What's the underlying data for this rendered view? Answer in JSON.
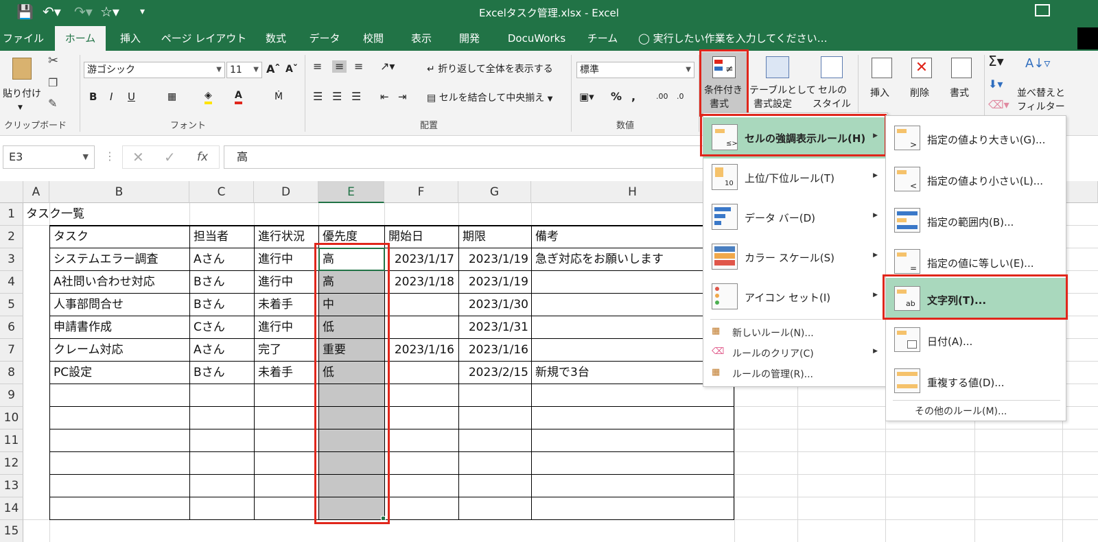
{
  "title": "Excelタスク管理.xlsx - Excel",
  "tabs": [
    "ファイル",
    "ホーム",
    "挿入",
    "ページ レイアウト",
    "数式",
    "データ",
    "校閲",
    "表示",
    "開発",
    "DocuWorks",
    "チーム"
  ],
  "active_tab": "ホーム",
  "tell_me": "実行したい作業を入力してください…",
  "ribbon": {
    "paste": "貼り付け",
    "clipboard_group": "クリップボード",
    "font_name": "游ゴシック",
    "font_size": "11",
    "font_group": "フォント",
    "wrap_text": "折り返して全体を表示する",
    "merge_center": "セルを結合して中央揃え",
    "alignment_group": "配置",
    "number_format": "標準",
    "number_group": "数値",
    "conditional_formatting_line1": "条件付き",
    "conditional_formatting_line2": "書式",
    "format_as_table_line1": "テーブルとして",
    "format_as_table_line2": "書式設定",
    "cell_styles_line1": "セルの",
    "cell_styles_line2": "スタイル",
    "insert": "挿入",
    "delete": "削除",
    "format": "書式",
    "sort_filter_line1": "並べ替えと",
    "sort_filter_line2": "フィルター"
  },
  "formula_bar": {
    "name_box": "E3",
    "content": "高"
  },
  "columns": [
    "A",
    "B",
    "C",
    "D",
    "E",
    "F",
    "G",
    "H"
  ],
  "rows": [
    "1",
    "2",
    "3",
    "4",
    "5",
    "6",
    "7",
    "8",
    "9",
    "10",
    "11",
    "12",
    "13",
    "14",
    "15"
  ],
  "sheet": {
    "title": "タスク一覧",
    "headers": [
      "タスク",
      "担当者",
      "進行状況",
      "優先度",
      "開始日",
      "期限",
      "備考"
    ],
    "data": [
      [
        "システムエラー調査",
        "Aさん",
        "進行中",
        "高",
        "2023/1/17",
        "2023/1/19",
        "急ぎ対応をお願いします"
      ],
      [
        "A社問い合わせ対応",
        "Bさん",
        "進行中",
        "高",
        "2023/1/18",
        "2023/1/19",
        ""
      ],
      [
        "人事部問合せ",
        "Bさん",
        "未着手",
        "中",
        "",
        "2023/1/30",
        ""
      ],
      [
        "申請書作成",
        "Cさん",
        "進行中",
        "低",
        "",
        "2023/1/31",
        ""
      ],
      [
        "クレーム対応",
        "Aさん",
        "完了",
        "重要",
        "2023/1/16",
        "2023/1/16",
        ""
      ],
      [
        "PC設定",
        "Bさん",
        "未着手",
        "低",
        "",
        "2023/2/15",
        "新規で3台"
      ]
    ]
  },
  "cf_menu": {
    "items": [
      {
        "label": "セルの強調表示ルール(H)",
        "icon": "highlight-rules-icon"
      },
      {
        "label": "上位/下位ルール(T)",
        "icon": "top-bottom-icon"
      },
      {
        "label": "データ バー(D)",
        "icon": "data-bars-icon"
      },
      {
        "label": "カラー スケール(S)",
        "icon": "color-scales-icon"
      },
      {
        "label": "アイコン セット(I)",
        "icon": "icon-sets-icon"
      }
    ],
    "small_items": [
      "新しいルール(N)...",
      "ルールのクリア(C)",
      "ルールの管理(R)..."
    ]
  },
  "highlight_submenu": {
    "items": [
      {
        "label": "指定の値より大きい(G)...",
        "icon": "greater-than-icon"
      },
      {
        "label": "指定の値より小さい(L)...",
        "icon": "less-than-icon"
      },
      {
        "label": "指定の範囲内(B)...",
        "icon": "between-icon"
      },
      {
        "label": "指定の値に等しい(E)...",
        "icon": "equal-to-icon"
      },
      {
        "label": "文字列(T)...",
        "icon": "text-contains-icon"
      },
      {
        "label": "日付(A)...",
        "icon": "date-icon"
      },
      {
        "label": "重複する値(D)...",
        "icon": "duplicate-values-icon"
      }
    ],
    "more_rules": "その他のルール(M)..."
  },
  "colors": {
    "excel_green": "#217346",
    "menu_highlight": "#a9d8bd",
    "annotation_red": "#e0261b",
    "selection_fill": "#c6c6c6"
  }
}
